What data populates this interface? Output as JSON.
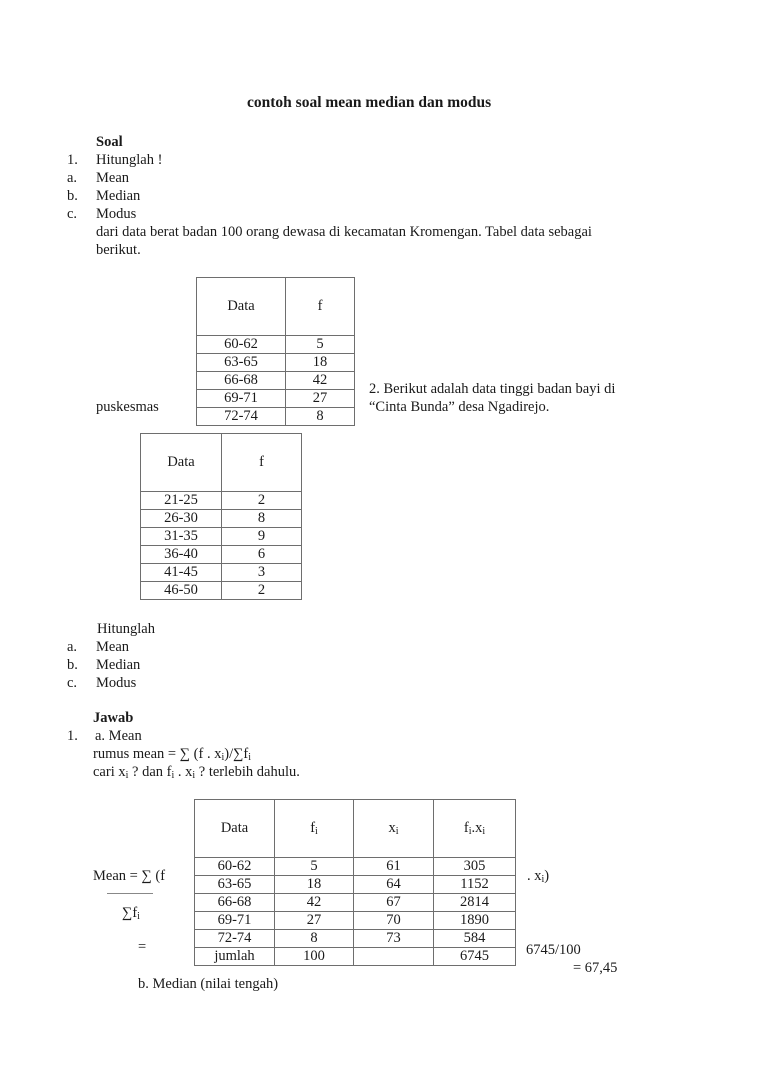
{
  "title": "contoh soal mean median dan modus",
  "soal": {
    "heading": "Soal",
    "q1": {
      "num": "1.",
      "text": "Hitunglah !",
      "items": [
        {
          "marker": "a.",
          "label": "Mean"
        },
        {
          "marker": "b.",
          "label": "Median"
        },
        {
          "marker": "c.",
          "label": "Modus"
        }
      ],
      "desc_line1": "dari data berat badan 100 orang dewasa di kecamatan Kromengan. Tabel data sebagai",
      "desc_line2": "berikut."
    },
    "table1": {
      "headers": [
        "Data",
        "f"
      ],
      "rows": [
        [
          "60-62",
          "5"
        ],
        [
          "63-65",
          "18"
        ],
        [
          "66-68",
          "42"
        ],
        [
          "69-71",
          "27"
        ],
        [
          "72-74",
          "8"
        ]
      ]
    },
    "q2": {
      "line1": "2.    Berikut adalah data tinggi badan bayi di",
      "line2": "“Cinta Bunda” desa Ngadirejo.",
      "puskesmas": "puskesmas"
    },
    "table2": {
      "headers": [
        "Data",
        "f"
      ],
      "rows": [
        [
          "21-25",
          "2"
        ],
        [
          "26-30",
          "8"
        ],
        [
          "31-35",
          "9"
        ],
        [
          "36-40",
          "6"
        ],
        [
          "41-45",
          "3"
        ],
        [
          "46-50",
          "2"
        ]
      ]
    },
    "q2_tasks": {
      "text": "Hitunglah",
      "items": [
        {
          "marker": "a.",
          "label": "Mean"
        },
        {
          "marker": "b.",
          "label": "Median"
        },
        {
          "marker": "c.",
          "label": "Modus"
        }
      ]
    }
  },
  "jawab": {
    "heading": "Jawab",
    "num": "1.",
    "sub_a": "a. Mean",
    "formula_line": "rumus mean = ∑ (f . x",
    "formula_tail": ")/∑f",
    "cari_prefix": "cari x",
    "cari_mid1": " ? dan f",
    "cari_mid2": " . x",
    "cari_suffix": " ? terlebih dahulu.",
    "sub_i": "i",
    "table3": {
      "headers": [
        "Data",
        "f",
        "x",
        "f",
        "x"
      ],
      "rows": [
        [
          "60-62",
          "5",
          "61",
          "305"
        ],
        [
          "63-65",
          "18",
          "64",
          "1152"
        ],
        [
          "66-68",
          "42",
          "67",
          "2814"
        ],
        [
          "69-71",
          "27",
          "70",
          "1890"
        ],
        [
          "72-74",
          "8",
          "73",
          "584"
        ],
        [
          "jumlah",
          "100",
          "",
          "6745"
        ]
      ]
    },
    "mean_calc": {
      "numerator": "Mean   = ∑ (f",
      "numerator_tail": ". x",
      "denominator": "∑f",
      "equals": "=",
      "division": "6745/100",
      "result": "= 67,45"
    },
    "sub_b": "b. Median (nilai tengah)"
  }
}
